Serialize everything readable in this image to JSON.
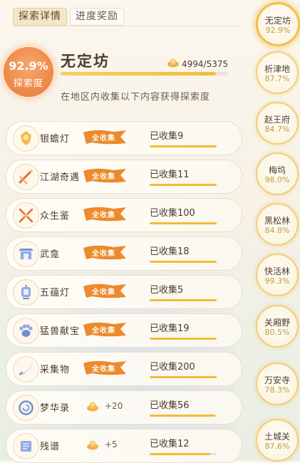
{
  "tabs": [
    {
      "label": "探索详情",
      "active": true
    },
    {
      "label": "进度奖励",
      "active": false
    }
  ],
  "region": {
    "title": "无定坊",
    "percent_text": "92.9%",
    "percent_label": "探索度",
    "progress_text": "4994/5375",
    "progress_fraction": 0.929,
    "description": "在地区内收集以下内容获得探索度"
  },
  "items": [
    {
      "name": "银蟾灯",
      "icon": "golden-lantern-icon",
      "badge": "全收集",
      "collected": "已收集9",
      "fill": 1.0
    },
    {
      "name": "江湖奇遇",
      "icon": "sword-slash-icon",
      "badge": "全收集",
      "collected": "已收集11",
      "fill": 1.0
    },
    {
      "name": "众生鉴",
      "icon": "crossed-swords-icon",
      "badge": "全收集",
      "collected": "已收集100",
      "fill": 1.0
    },
    {
      "name": "武龛",
      "icon": "shrine-icon",
      "badge": "全收集",
      "collected": "已收集18",
      "fill": 1.0
    },
    {
      "name": "五蕴灯",
      "icon": "lantern-icon",
      "badge": "全收集",
      "collected": "已收集5",
      "fill": 1.0
    },
    {
      "name": "猛兽献宝",
      "icon": "paw-icon",
      "badge": "全收集",
      "collected": "已收集19",
      "fill": 1.0
    },
    {
      "name": "采集物",
      "icon": "sickle-icon",
      "badge": "全收集",
      "collected": "已收集200",
      "fill": 1.0
    },
    {
      "name": "梦华录",
      "icon": "swirl-icon",
      "reward": "+20",
      "collected": "已收集56",
      "fill": 0.98
    },
    {
      "name": "残谱",
      "icon": "scroll-icon",
      "reward": "+5",
      "collected": "已收集12",
      "fill": 0.9
    }
  ],
  "regions": [
    {
      "name": "无定坊",
      "percent": "92.9%",
      "active": true
    },
    {
      "name": "析津地",
      "percent": "87.7%"
    },
    {
      "name": "赵王府",
      "percent": "84.7%"
    },
    {
      "name": "梅坞",
      "percent": "98.0%"
    },
    {
      "name": "黑松林",
      "percent": "84.8%"
    },
    {
      "name": "快活林",
      "percent": "99.3%"
    },
    {
      "name": "关厢野",
      "percent": "80.5%"
    },
    {
      "name": "万安寺",
      "percent": "78.3%"
    },
    {
      "name": "土城关",
      "percent": "87.6%"
    }
  ],
  "colors": {
    "accent_orange": "#ef8b4a",
    "progress_gold": "#f1bd35",
    "banner_orange": "#ec8a2e"
  }
}
